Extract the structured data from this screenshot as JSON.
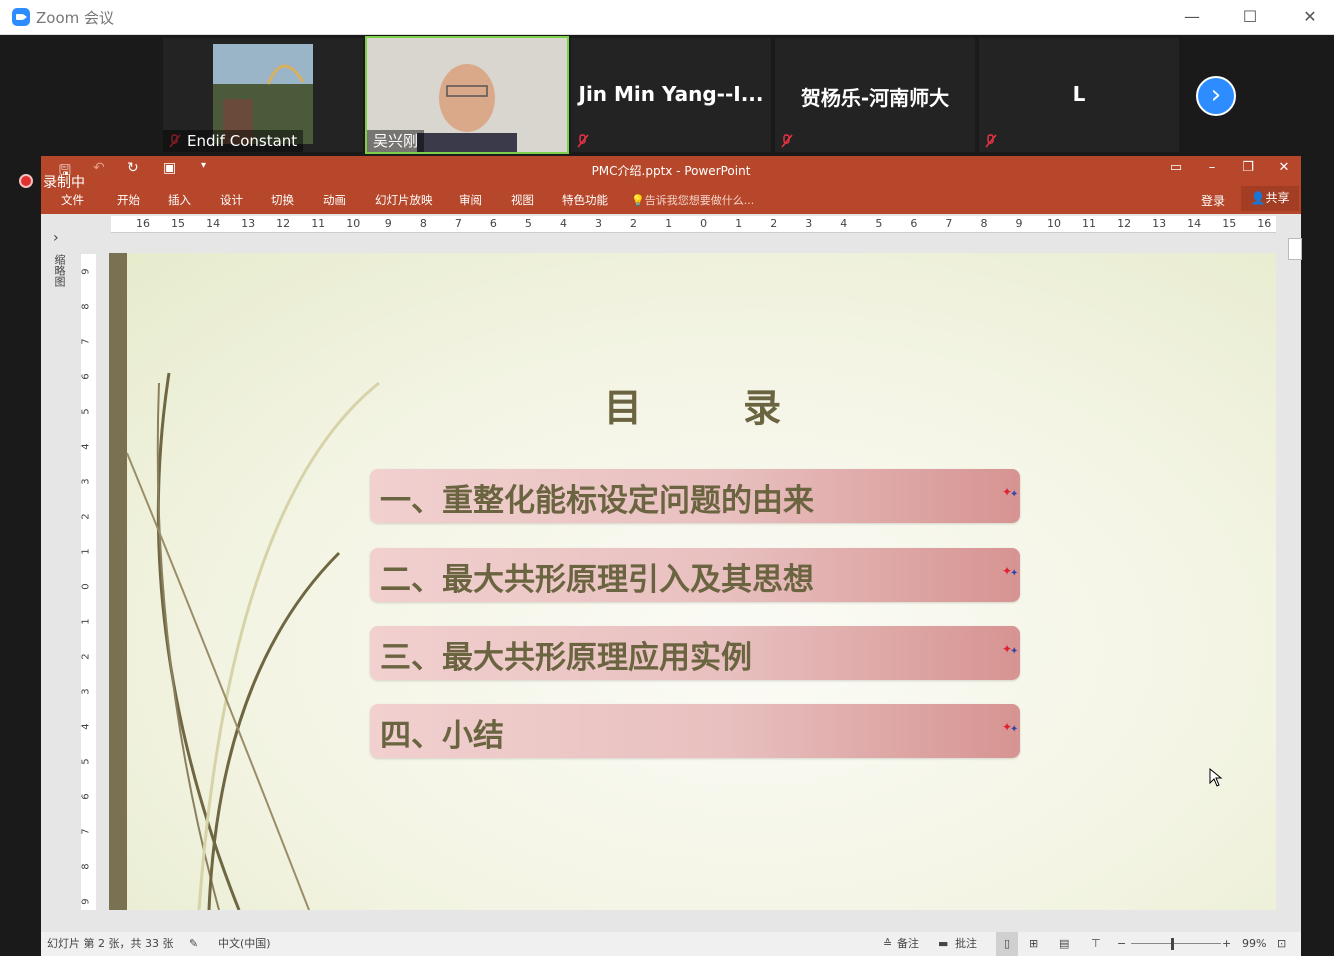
{
  "zoom": {
    "title": "Zoom 会议",
    "participants": [
      {
        "name": "Endif Constant",
        "muted": true,
        "video": true
      },
      {
        "name": "吴兴刚",
        "muted": false,
        "video": true,
        "active": true
      },
      {
        "name": "Jin Min Yang--I...",
        "muted": true,
        "video": false
      },
      {
        "name": "贺杨乐-河南师大",
        "muted": true,
        "video": false
      },
      {
        "name": "L",
        "muted": true,
        "video": false
      }
    ],
    "recording_label": "录制中"
  },
  "ppt": {
    "title": "PMC介绍.pptx - PowerPoint",
    "menu": [
      "文件",
      "开始",
      "插入",
      "设计",
      "切换",
      "动画",
      "幻灯片放映",
      "审阅",
      "视图",
      "特色功能"
    ],
    "tell_me": "告诉我您想要做什么...",
    "login": "登录",
    "share": "共享",
    "thumbs_label": "缩略图",
    "ruler_numbers": [
      "16",
      "15",
      "14",
      "13",
      "12",
      "11",
      "10",
      "9",
      "8",
      "7",
      "6",
      "5",
      "4",
      "3",
      "2",
      "1",
      "0",
      "1",
      "2",
      "3",
      "4",
      "5",
      "6",
      "7",
      "8",
      "9",
      "10",
      "11",
      "12",
      "13",
      "14",
      "15",
      "16"
    ],
    "vruler_numbers": [
      "9",
      "8",
      "7",
      "6",
      "5",
      "4",
      "3",
      "2",
      "1",
      "0",
      "1",
      "2",
      "3",
      "4",
      "5",
      "6",
      "7",
      "8",
      "9"
    ],
    "slide": {
      "title": "目 录",
      "items": [
        "一、重整化能标设定问题的由来",
        "二、最大共形原理引入及其思想",
        "三、最大共形原理应用实例",
        "四、小结"
      ]
    },
    "status": {
      "slide_info": "幻灯片 第 2 张，共 33 张",
      "language": "中文(中国)",
      "notes": "备注",
      "comments": "批注",
      "zoom": "99%"
    }
  },
  "colors": {
    "ppt_accent": "#b7472a",
    "zoom_blue": "#2d8cff",
    "toc_text": "#6b6440"
  }
}
